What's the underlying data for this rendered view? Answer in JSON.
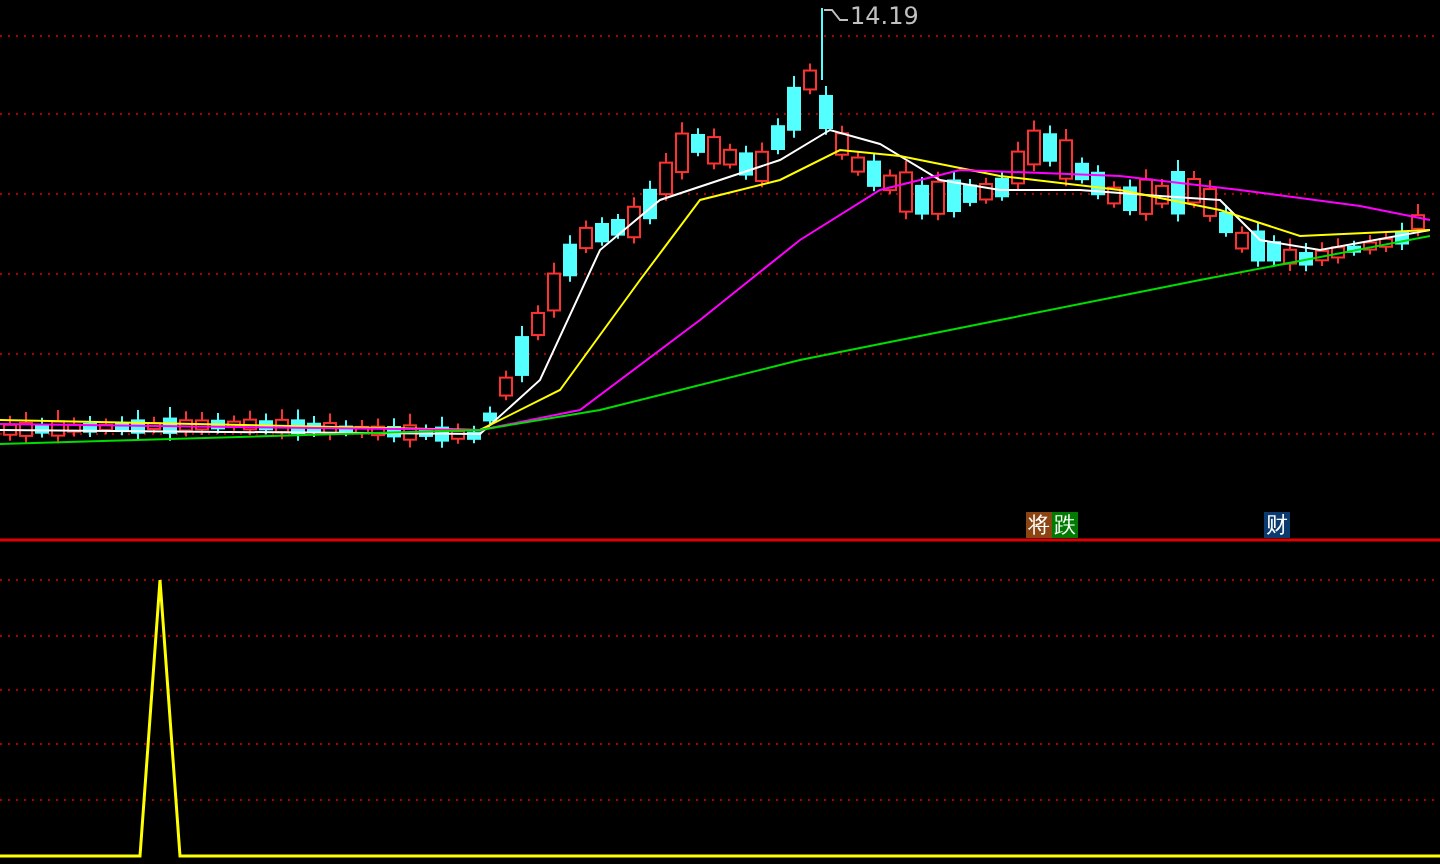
{
  "price_chart": {
    "high_label": "14.19",
    "signal_groups": [
      {
        "chars": [
          {
            "text": "将",
            "color": "#8b4513"
          },
          {
            "text": "跌",
            "color": "#007a00"
          }
        ]
      },
      {
        "chars": [
          {
            "text": "财",
            "color": "#0a3a6e"
          }
        ]
      }
    ]
  }
}
